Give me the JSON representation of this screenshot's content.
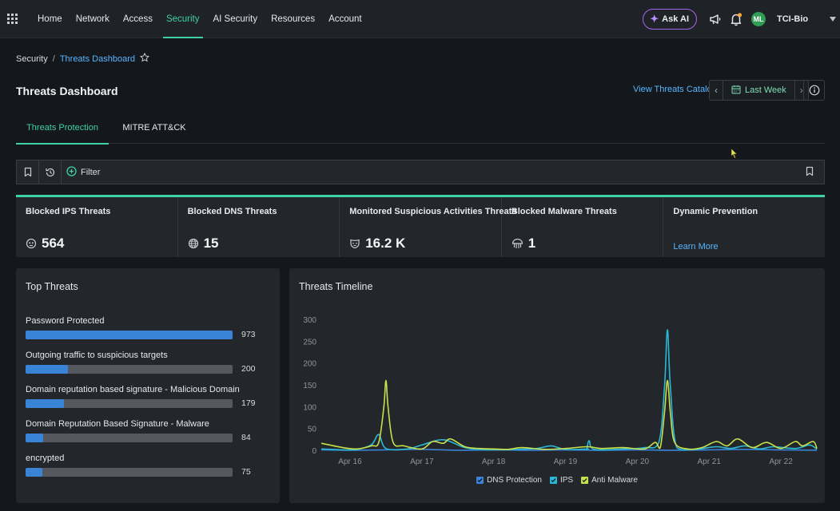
{
  "nav": {
    "items": [
      {
        "label": "Home",
        "name": "nav-home",
        "active": false
      },
      {
        "label": "Network",
        "name": "nav-network",
        "active": false
      },
      {
        "label": "Access",
        "name": "nav-access",
        "active": false
      },
      {
        "label": "Security",
        "name": "nav-security",
        "active": true
      },
      {
        "label": "AI Security",
        "name": "nav-ai-security",
        "active": false
      },
      {
        "label": "Resources",
        "name": "nav-resources",
        "active": false
      },
      {
        "label": "Account",
        "name": "nav-account",
        "active": false
      }
    ],
    "ask_ai": "Ask AI",
    "avatar_initials": "ML",
    "org": "TCI-Bio",
    "accent": "#3fd0a7"
  },
  "breadcrumb": {
    "root": "Security",
    "separator": "/",
    "current": "Threats Dashboard"
  },
  "page": {
    "title": "Threats Dashboard",
    "catalog_link": "View Threats Catalog",
    "date_range": "Last Week"
  },
  "tabs": [
    {
      "label": "Threats Protection",
      "active": true
    },
    {
      "label": "MITRE ATT&CK",
      "active": false
    }
  ],
  "filter": {
    "label": "Filter"
  },
  "stats": [
    {
      "label": "Blocked IPS Threats",
      "value": "564",
      "icon": "shield-bug-icon"
    },
    {
      "label": "Blocked DNS Threats",
      "value": "15",
      "icon": "globe-icon"
    },
    {
      "label": "Monitored Suspicious Activities Threats",
      "value": "16.2 K",
      "icon": "mask-icon"
    },
    {
      "label": "Blocked Malware Threats",
      "value": "1",
      "icon": "jellyfish-icon"
    },
    {
      "label": "Dynamic Prevention",
      "link": "Learn More"
    }
  ],
  "top_threats": {
    "title": "Top Threats",
    "items": [
      {
        "label": "Password Protected",
        "count": 973
      },
      {
        "label": "Outgoing traffic to suspicious targets",
        "count": 200
      },
      {
        "label": "Domain reputation based signature - Malicious Domain",
        "count": 179
      },
      {
        "label": "Domain Reputation Based Signature - Malware",
        "count": 84
      },
      {
        "label": "encrypted",
        "count": 75
      }
    ],
    "max": 973,
    "bar_color": "#3a84d8"
  },
  "chart_data": {
    "type": "line",
    "title": "Threats Timeline",
    "x_ticks": [
      "Apr 16",
      "Apr 17",
      "Apr 18",
      "Apr 19",
      "Apr 20",
      "Apr 21",
      "Apr 22"
    ],
    "x_range": [
      15.6,
      22.5
    ],
    "ylim": [
      0,
      300
    ],
    "y_ticks": [
      0,
      50,
      100,
      150,
      200,
      250,
      300
    ],
    "grid": false,
    "legend_position": "bottom",
    "series": [
      {
        "name": "DNS Protection",
        "color": "#3a84d8",
        "points": [
          [
            15.6,
            3
          ],
          [
            16.0,
            2
          ],
          [
            16.5,
            3
          ],
          [
            17.0,
            4
          ],
          [
            17.5,
            2
          ],
          [
            18.0,
            3
          ],
          [
            18.5,
            2
          ],
          [
            19.0,
            3
          ],
          [
            19.5,
            2
          ],
          [
            20.0,
            3
          ],
          [
            20.5,
            2
          ],
          [
            21.0,
            3
          ],
          [
            21.5,
            4
          ],
          [
            22.0,
            3
          ],
          [
            22.5,
            2
          ]
        ]
      },
      {
        "name": "IPS",
        "color": "#2ab8d6",
        "points": [
          [
            15.6,
            5
          ],
          [
            15.9,
            3
          ],
          [
            16.1,
            4
          ],
          [
            16.3,
            15
          ],
          [
            16.4,
            38
          ],
          [
            16.5,
            6
          ],
          [
            16.8,
            5
          ],
          [
            17.0,
            14
          ],
          [
            17.3,
            26
          ],
          [
            17.6,
            8
          ],
          [
            17.9,
            3
          ],
          [
            18.3,
            4
          ],
          [
            18.6,
            6
          ],
          [
            18.8,
            12
          ],
          [
            19.0,
            4
          ],
          [
            19.3,
            5
          ],
          [
            19.3,
            6
          ],
          [
            19.33,
            24
          ],
          [
            19.4,
            4
          ],
          [
            19.8,
            5
          ],
          [
            20.1,
            8
          ],
          [
            20.3,
            20
          ],
          [
            20.38,
            150
          ],
          [
            20.42,
            278
          ],
          [
            20.46,
            150
          ],
          [
            20.55,
            8
          ],
          [
            20.8,
            4
          ],
          [
            21.1,
            10
          ],
          [
            21.3,
            6
          ],
          [
            21.5,
            12
          ],
          [
            21.7,
            5
          ],
          [
            21.9,
            10
          ],
          [
            22.2,
            6
          ],
          [
            22.4,
            14
          ],
          [
            22.5,
            4
          ]
        ]
      },
      {
        "name": "Anti Malware",
        "color": "#c9e04a",
        "points": [
          [
            15.6,
            18
          ],
          [
            15.9,
            8
          ],
          [
            16.1,
            5
          ],
          [
            16.3,
            12
          ],
          [
            16.4,
            20
          ],
          [
            16.47,
            100
          ],
          [
            16.5,
            162
          ],
          [
            16.53,
            100
          ],
          [
            16.6,
            20
          ],
          [
            16.75,
            12
          ],
          [
            17.0,
            5
          ],
          [
            17.15,
            22
          ],
          [
            17.3,
            18
          ],
          [
            17.4,
            28
          ],
          [
            17.6,
            10
          ],
          [
            17.8,
            6
          ],
          [
            18.0,
            5
          ],
          [
            18.2,
            4
          ],
          [
            18.4,
            8
          ],
          [
            18.7,
            4
          ],
          [
            19.0,
            6
          ],
          [
            19.3,
            10
          ],
          [
            19.5,
            6
          ],
          [
            19.8,
            8
          ],
          [
            20.1,
            5
          ],
          [
            20.25,
            20
          ],
          [
            20.32,
            8
          ],
          [
            20.38,
            90
          ],
          [
            20.42,
            162
          ],
          [
            20.46,
            90
          ],
          [
            20.52,
            20
          ],
          [
            20.7,
            5
          ],
          [
            20.9,
            8
          ],
          [
            21.1,
            22
          ],
          [
            21.25,
            12
          ],
          [
            21.4,
            28
          ],
          [
            21.6,
            8
          ],
          [
            21.8,
            20
          ],
          [
            22.0,
            6
          ],
          [
            22.2,
            22
          ],
          [
            22.3,
            12
          ],
          [
            22.45,
            22
          ],
          [
            22.5,
            6
          ]
        ]
      }
    ]
  }
}
